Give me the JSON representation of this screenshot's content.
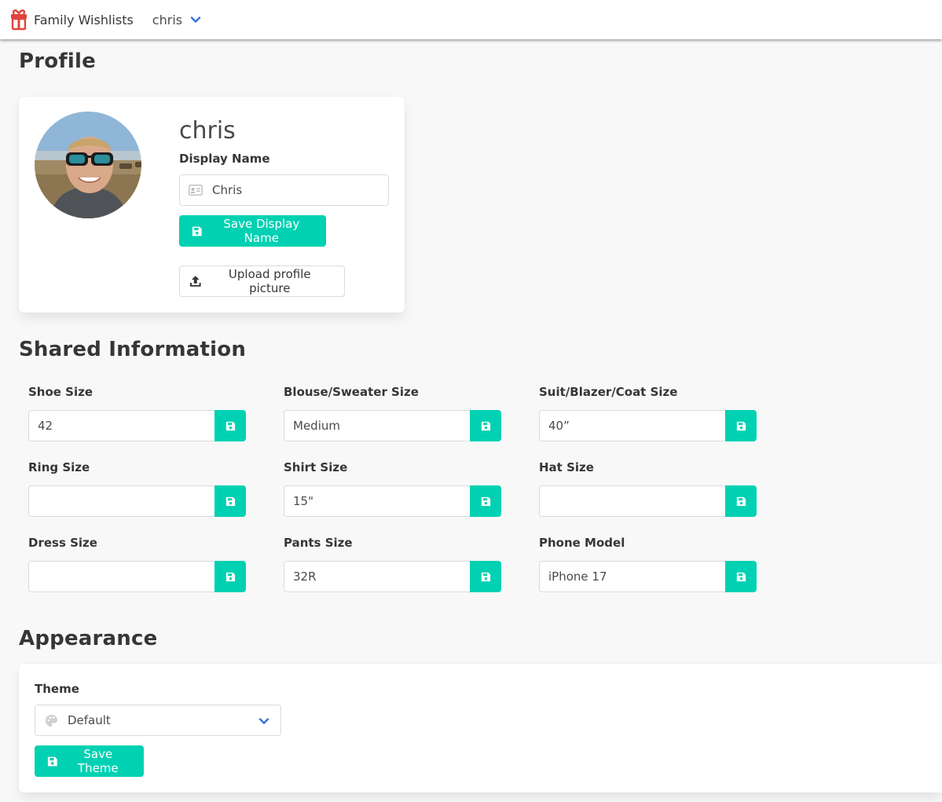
{
  "navbar": {
    "brand_text": "Family Wishlists",
    "user_menu_text": "chris",
    "brand_icon": "gift-icon",
    "user_menu_icon": "chevron-down-icon"
  },
  "profile": {
    "title": "Profile",
    "username": "chris",
    "display_name_label": "Display Name",
    "display_name_value": "Chris",
    "display_name_icon": "id-card-icon",
    "save_display_name_label": "Save Display Name",
    "upload_picture_label": "Upload profile picture"
  },
  "shared": {
    "title": "Shared Information",
    "fields": [
      {
        "label": "Shoe Size",
        "value": "42"
      },
      {
        "label": "Blouse/Sweater Size",
        "value": "Medium"
      },
      {
        "label": "Suit/Blazer/Coat Size",
        "value": "40”"
      },
      {
        "label": "Ring Size",
        "value": ""
      },
      {
        "label": "Shirt Size",
        "value": "15\""
      },
      {
        "label": "Hat Size",
        "value": ""
      },
      {
        "label": "Dress Size",
        "value": ""
      },
      {
        "label": "Pants Size",
        "value": "32R"
      },
      {
        "label": "Phone Model",
        "value": "iPhone 17"
      }
    ]
  },
  "appearance": {
    "title": "Appearance",
    "theme_label": "Theme",
    "theme_value": "Default",
    "theme_icon": "palette-icon",
    "save_theme_label": "Save Theme"
  },
  "colors": {
    "primary": "#00d1b2",
    "link": "#3273dc",
    "text": "#363636",
    "background": "#f8f8f8"
  }
}
